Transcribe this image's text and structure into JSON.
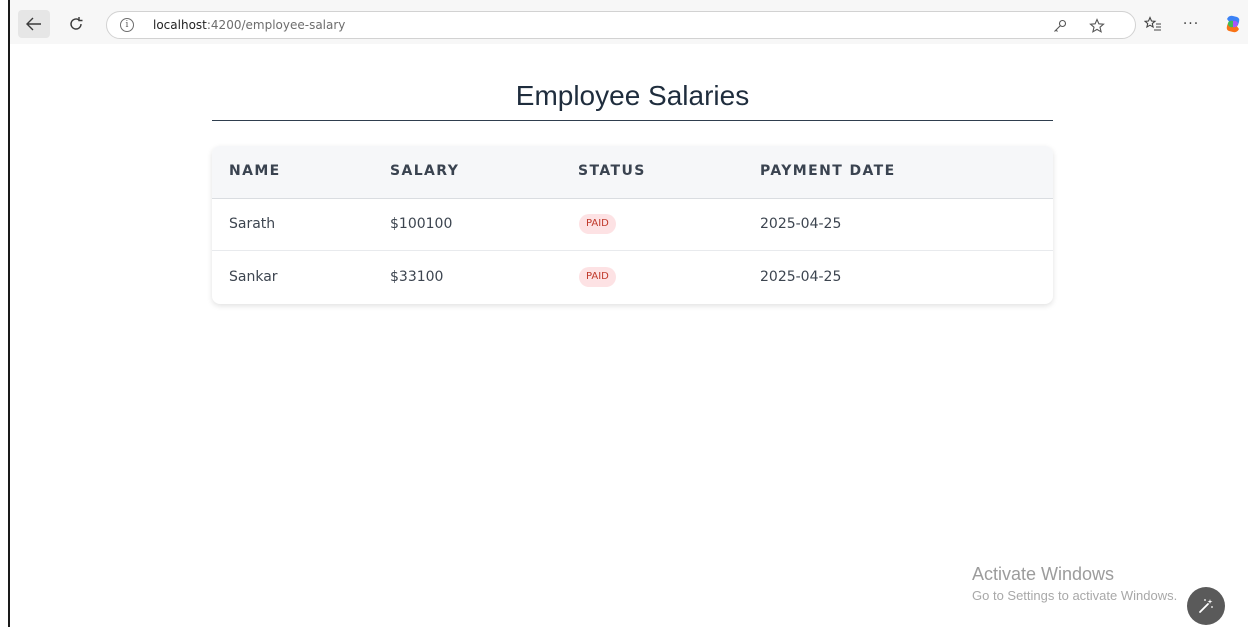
{
  "browser": {
    "url_host": "localhost",
    "url_path": ":4200/employee-salary",
    "icons": {
      "back": "back-arrow-icon",
      "reload": "reload-icon",
      "info": "info-icon",
      "key": "key-icon",
      "star": "star-icon",
      "favorites": "favorites-icon",
      "more": "more-icon",
      "copilot": "copilot-icon"
    },
    "info_glyph": "i",
    "more_glyph": "···"
  },
  "page": {
    "title": "Employee Salaries",
    "table": {
      "headers": {
        "name": "NAME",
        "salary": "SALARY",
        "status": "STATUS",
        "payment_date": "PAYMENT DATE"
      },
      "rows": [
        {
          "name": "Sarath",
          "salary": "$100100",
          "status": "PAID",
          "payment_date": "2025-04-25"
        },
        {
          "name": "Sankar",
          "salary": "$33100",
          "status": "PAID",
          "payment_date": "2025-04-25"
        }
      ]
    },
    "colors": {
      "title": "#1f2d3d",
      "badge_bg": "#fde2e4",
      "badge_text": "#c0392b",
      "header_bg": "#f6f7f9"
    }
  },
  "watermark": {
    "title": "Activate Windows",
    "subtitle": "Go to Settings to activate Windows."
  }
}
